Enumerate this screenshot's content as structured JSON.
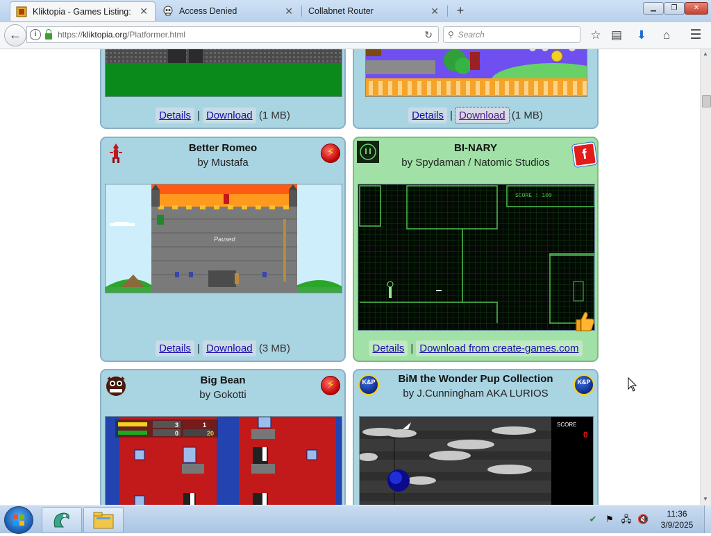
{
  "browser": {
    "tabs": [
      {
        "title": "Kliktopia - Games Listing: Pl",
        "active": true
      },
      {
        "title": "Access Denied",
        "active": false
      },
      {
        "title": "Collabnet Router",
        "active": false
      }
    ],
    "new_tab_symbol": "+",
    "address": {
      "prefix": "https://",
      "host": "kliktopia.org",
      "path": "/Platformer.html"
    },
    "search_placeholder": "Search"
  },
  "page": {
    "cards": [
      {
        "id": "top-left",
        "title": "",
        "author": "",
        "details_label": "Details",
        "download_label": "Download",
        "size": "(1 MB)",
        "separator": "|",
        "bg_color": "#a9d4e2"
      },
      {
        "id": "top-right",
        "title": "",
        "author": "",
        "details_label": "Details",
        "download_label": "Download",
        "size": "(1 MB)",
        "separator": "|",
        "bg_color": "#a9d4e2"
      },
      {
        "id": "better-romeo",
        "title": "Better Romeo",
        "author": "by Mustafa",
        "details_label": "Details",
        "download_label": "Download",
        "size": "(3 MB)",
        "separator": "|",
        "screenshot_text": "Paused",
        "bg_color": "#a9d4e2"
      },
      {
        "id": "bi-nary",
        "title": "BI-NARY",
        "author": "by Spydaman / Natomic Studios",
        "details_label": "Details",
        "download_label": "Download from create-games.com",
        "separator": "|",
        "screenshot_text": "SCORE : 100",
        "bg_color": "#a1e0a6"
      },
      {
        "id": "big-bean",
        "title": "Big Bean",
        "author": "by Gokotti",
        "hud": [
          "3",
          "1",
          "0",
          "20"
        ],
        "bg_color": "#a9d4e2"
      },
      {
        "id": "bim",
        "title": "BiM the Wonder Pup Collection",
        "author": "by J.Cunningham AKA LURIOS",
        "screenshot_score_label": "SCORE",
        "screenshot_score_value": "0",
        "bg_color": "#a9d4e2"
      }
    ],
    "badges": {
      "kp_text": "K&P",
      "flash_symbol": "⚡",
      "f_letter": "f"
    }
  },
  "taskbar": {
    "time": "11:36",
    "date": "3/9/2025"
  },
  "colors": {
    "link": "#1a0dab",
    "visited_link": "#551a8b",
    "card_blue": "#a9d4e2",
    "card_green": "#a1e0a6"
  }
}
